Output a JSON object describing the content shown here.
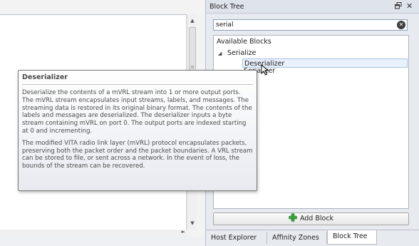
{
  "dock": {
    "title": "Block Tree",
    "pin_icon": "restore-icon",
    "close_glyph": "✕"
  },
  "search": {
    "value": "serial",
    "clear_glyph": "✕"
  },
  "tree": {
    "header": "Available Blocks",
    "group": {
      "label": "Serialize",
      "expanded": true,
      "items": [
        {
          "label": "Deserializer",
          "selected": true
        },
        {
          "label": "Serializer",
          "selected": false,
          "partially_hidden": true
        }
      ]
    }
  },
  "add_block": {
    "label": "Add Block",
    "icon": "green-plus-icon"
  },
  "tabs": [
    {
      "label": "Host Explorer",
      "active": false
    },
    {
      "label": "Affinity Zones",
      "active": false
    },
    {
      "label": "Block Tree",
      "active": true
    }
  ],
  "tooltip": {
    "title": "Deserializer",
    "paragraphs": [
      "Deserialize the contents of a mVRL stream into 1 or more output ports. The mVRL stream encapsulates input streams, labels, and messages. The streaming data is restored in its original binary format. The contents of the labels and messages are deserialized. The deserializer inputs a byte stream containing mVRL on port 0. The output ports are indexed starting at 0 and incrementing.",
      "The modified VITA radio link layer (mVRL) protocol encapsulates packets, preserving both the packet order and the packet boundaries. A VRL stream can be stored to file, or sent across a network. In the event of loss, the bounds of the stream can be recovered."
    ]
  },
  "colors": {
    "accent": "#a7c2e3",
    "add_icon": "#3aa63a"
  }
}
